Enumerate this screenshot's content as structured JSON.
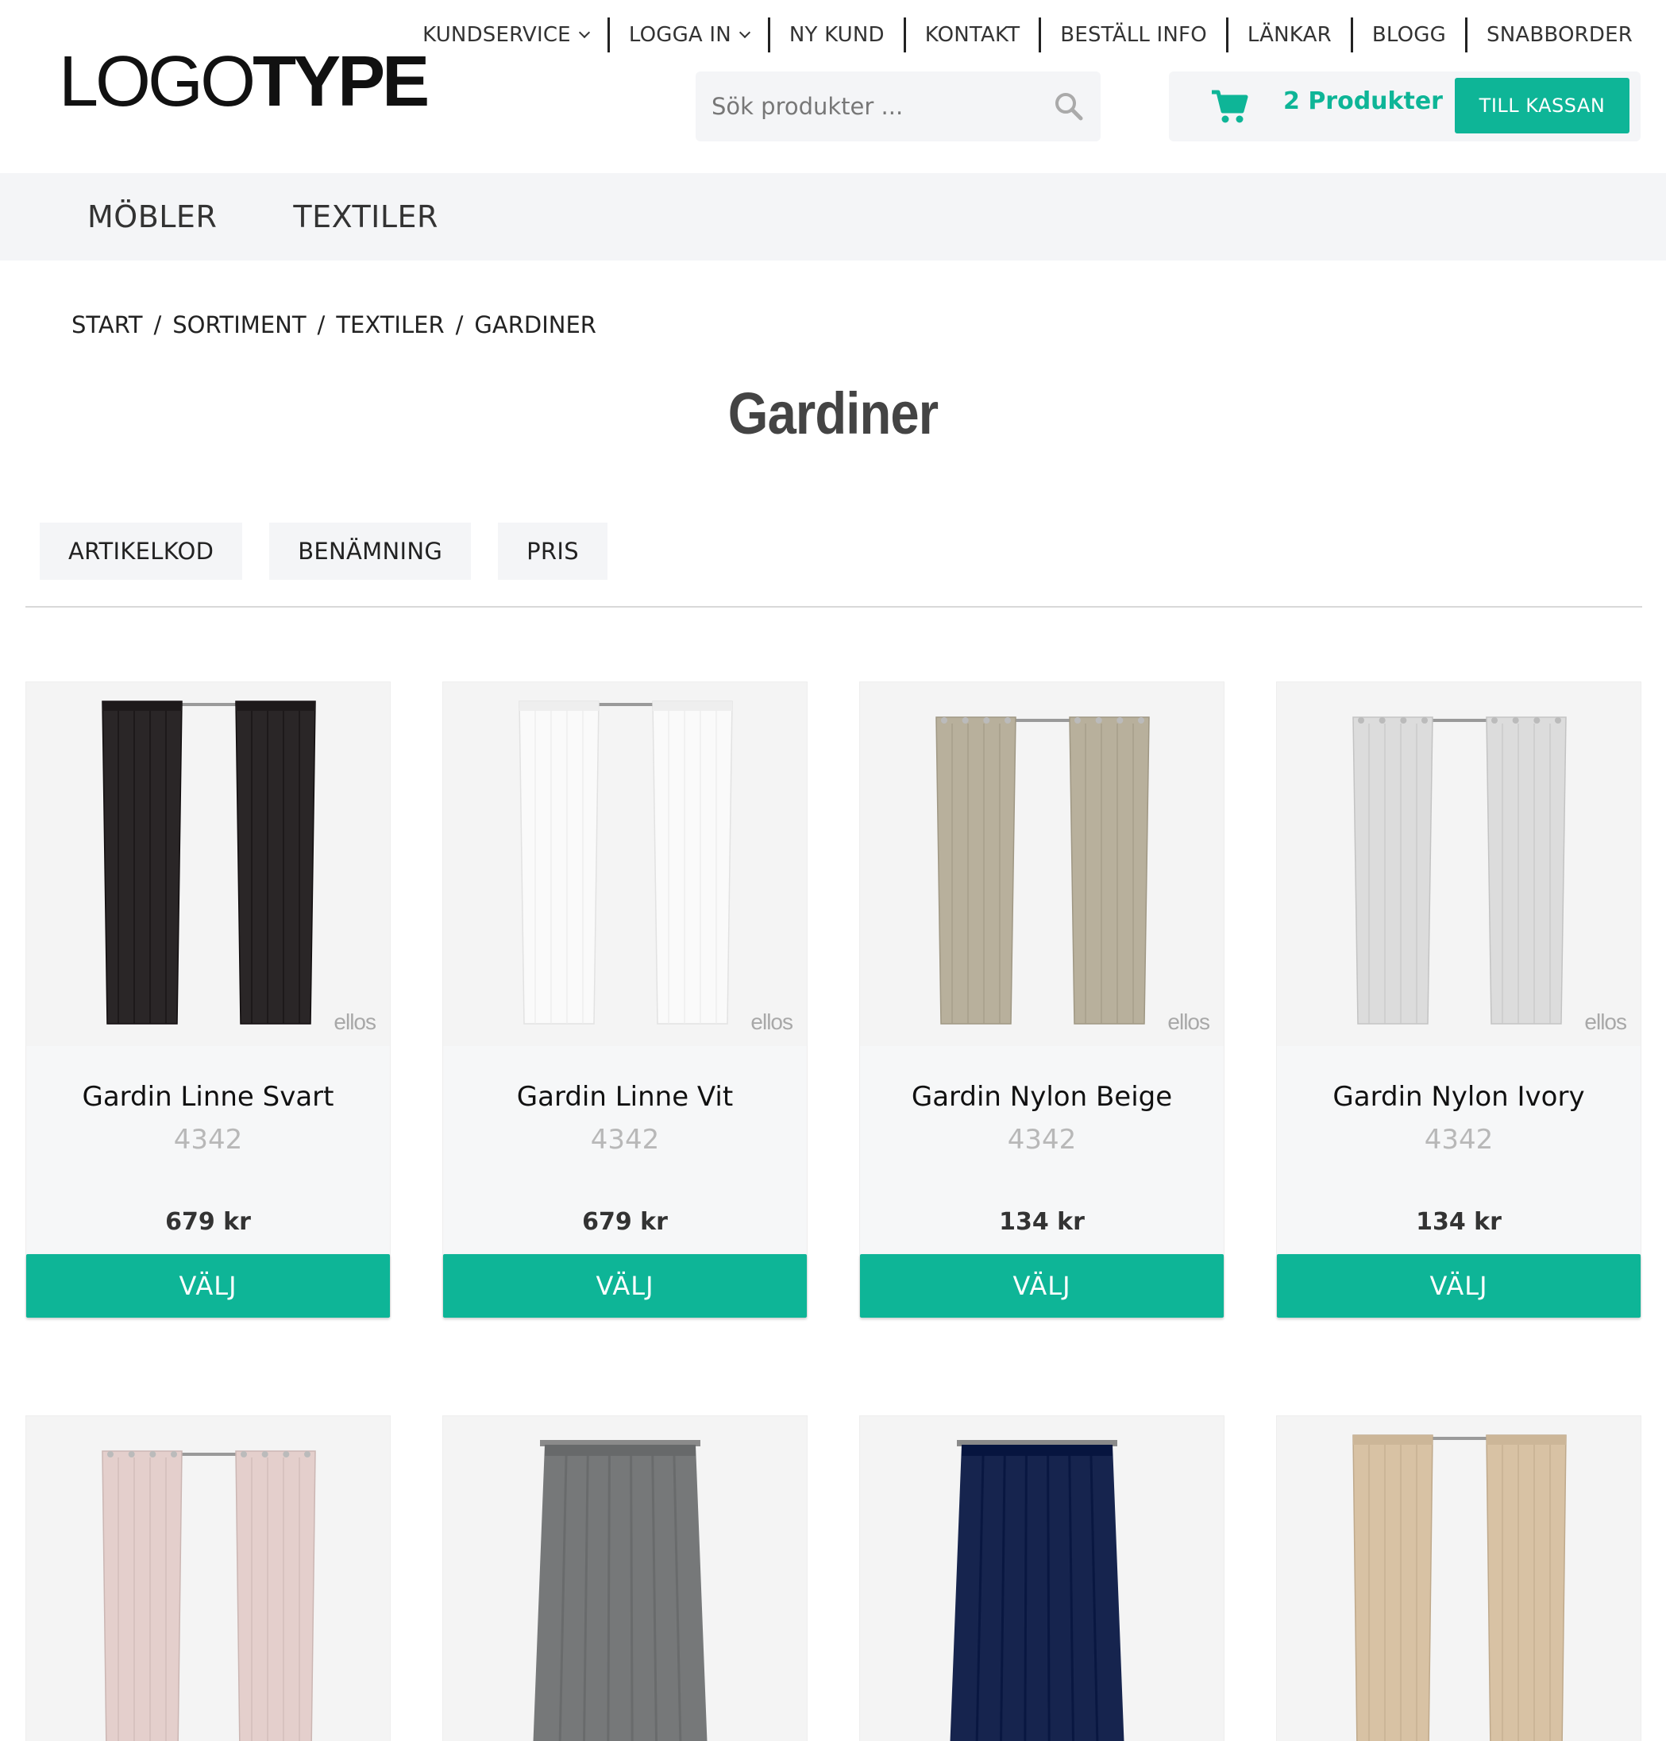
{
  "topnav": {
    "items": [
      {
        "label": "KUNDSERVICE",
        "dropdown": true
      },
      {
        "label": "LOGGA IN",
        "dropdown": true
      },
      {
        "label": "NY KUND",
        "dropdown": false
      },
      {
        "label": "KONTAKT",
        "dropdown": false
      },
      {
        "label": "BESTÄLL INFO",
        "dropdown": false
      },
      {
        "label": "LÄNKAR",
        "dropdown": false
      },
      {
        "label": "BLOGG",
        "dropdown": false
      },
      {
        "label": "SNABBORDER",
        "dropdown": false
      }
    ]
  },
  "logo": {
    "part1": "LOGO",
    "part2": "TYPE"
  },
  "search": {
    "placeholder": "Sök produkter ...",
    "icon": "search-icon"
  },
  "cart": {
    "count_label": "2 Produkter",
    "checkout_label": "TILL KASSAN",
    "icon": "cart-icon"
  },
  "categories": [
    "MÖBLER",
    "TEXTILER"
  ],
  "breadcrumb": [
    "START",
    "SORTIMENT",
    "TEXTILER",
    "GARDINER"
  ],
  "breadcrumb_separator": "/",
  "page_title": "Gardiner",
  "sort_buttons": [
    "ARTIKELKOD",
    "BENÄMNING",
    "PRIS"
  ],
  "products": [
    {
      "name": "Gardin Linne Svart",
      "code": "4342",
      "price": "679 kr",
      "button": "VÄLJ",
      "brand": "ellos",
      "color": "#2a2627",
      "style": "gather"
    },
    {
      "name": "Gardin Linne Vit",
      "code": "4342",
      "price": "679 kr",
      "button": "VÄLJ",
      "brand": "ellos",
      "color": "#fafafa",
      "style": "gather"
    },
    {
      "name": "Gardin Nylon Beige",
      "code": "4342",
      "price": "134 kr",
      "button": "VÄLJ",
      "brand": "ellos",
      "color": "#b8b09c",
      "style": "eyelet"
    },
    {
      "name": "Gardin Nylon Ivory",
      "code": "4342",
      "price": "134 kr",
      "button": "VÄLJ",
      "brand": "ellos",
      "color": "#dcdcdc",
      "style": "eyelet"
    }
  ],
  "products_row2": [
    {
      "color": "#e4cfcc",
      "style": "eyelet"
    },
    {
      "color": "#767879",
      "style": "panel"
    },
    {
      "color": "#16244e",
      "style": "panel"
    },
    {
      "color": "#d8c2a4",
      "style": "gather"
    }
  ],
  "colors": {
    "accent": "#0eb597",
    "bar_bg": "#f4f5f7",
    "title": "#444444"
  }
}
